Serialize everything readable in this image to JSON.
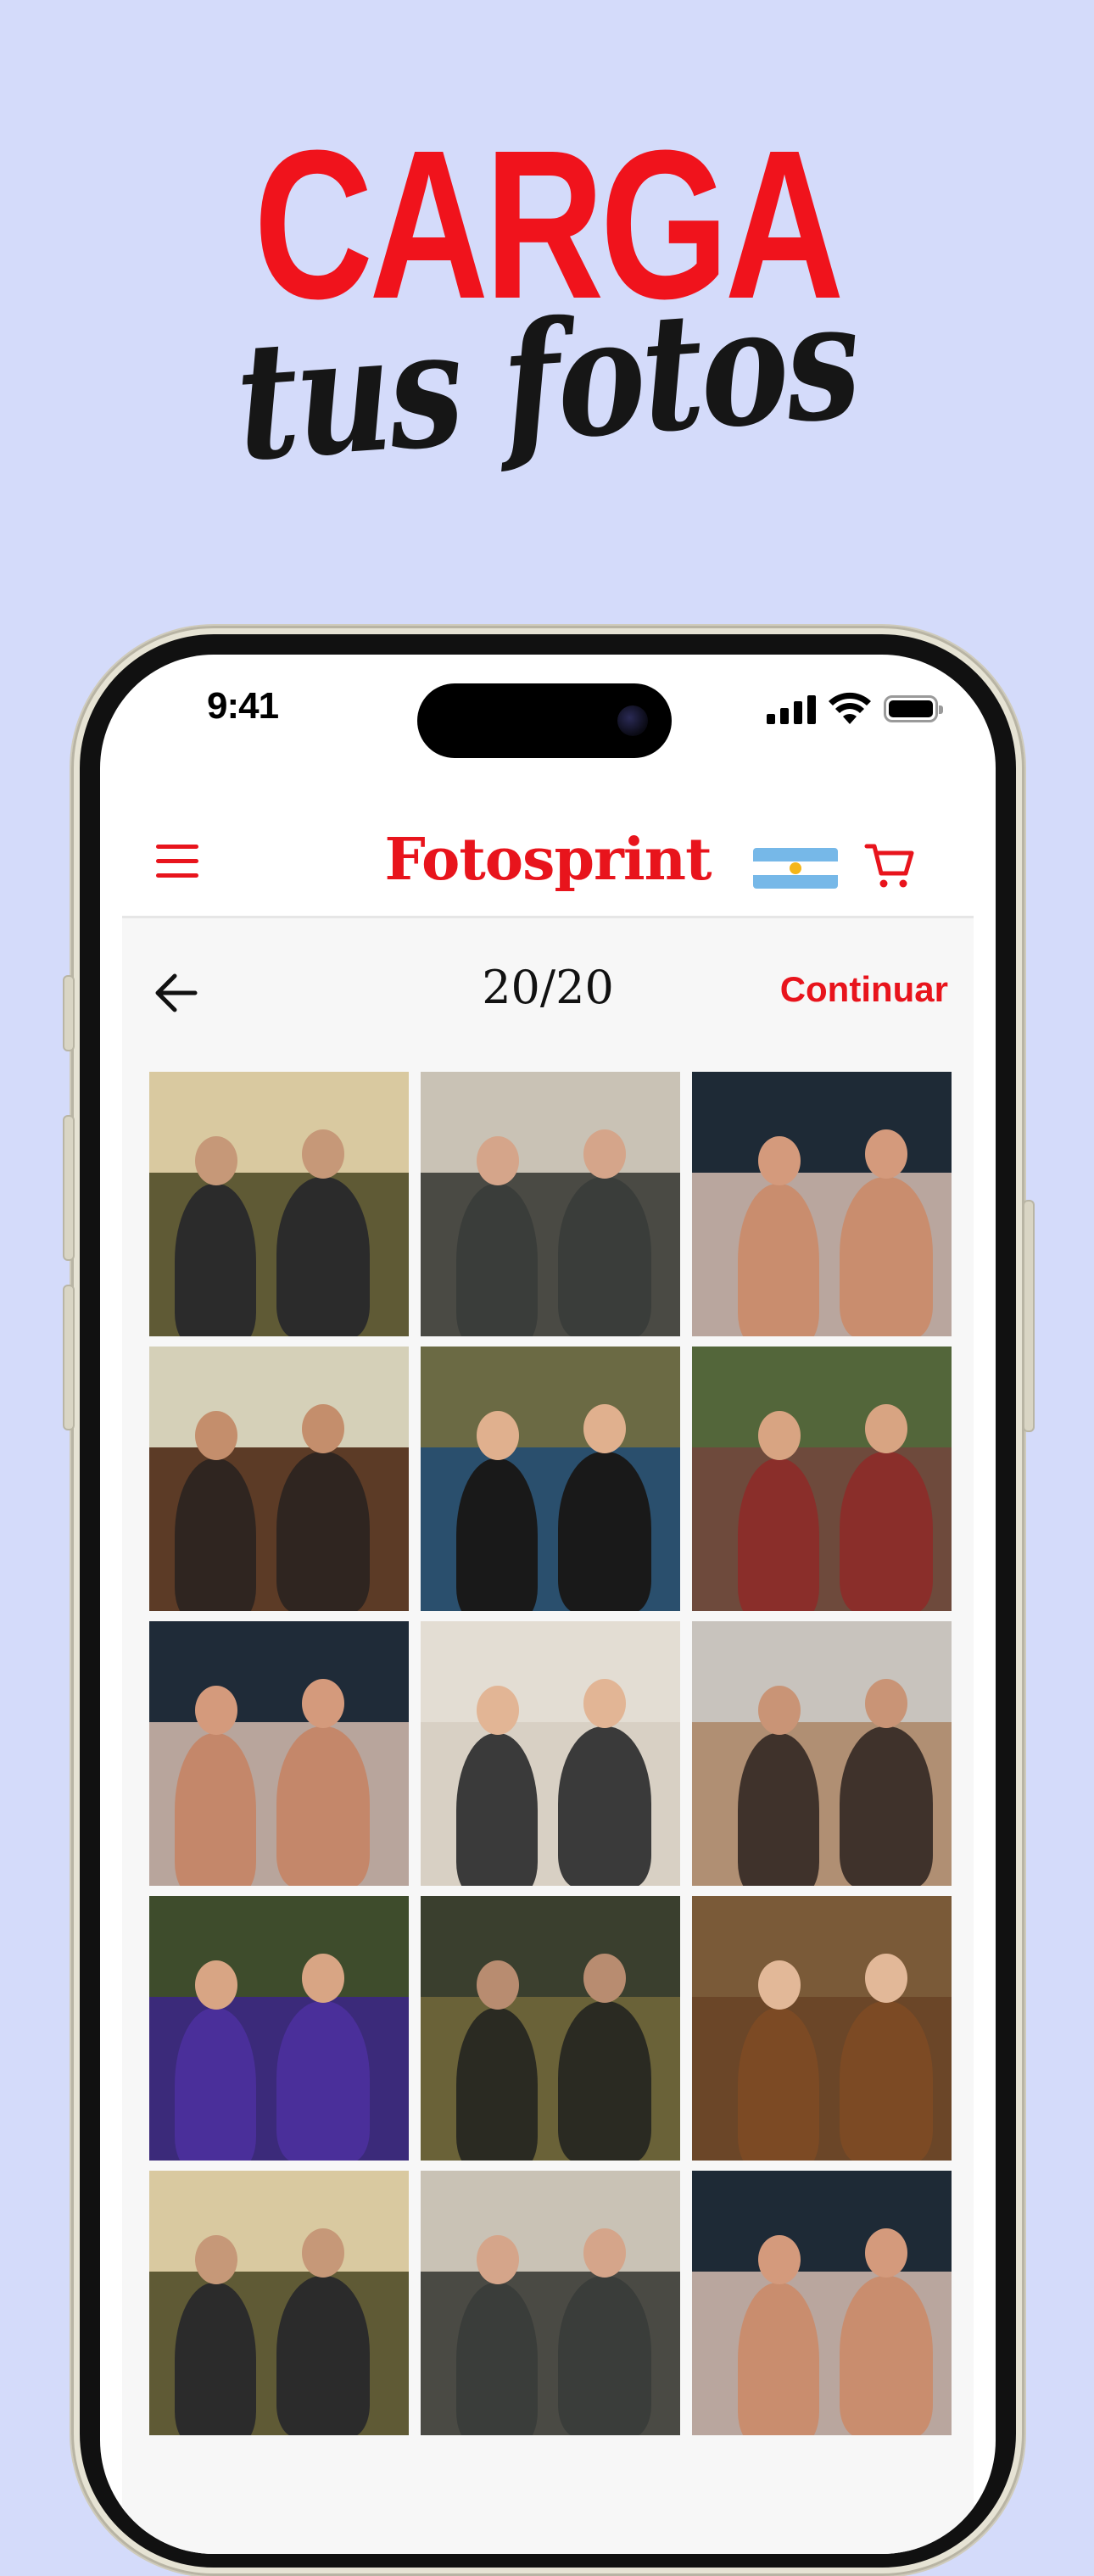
{
  "headline": {
    "big": "CARGA",
    "script": "tus fotos"
  },
  "status_bar": {
    "time": "9:41"
  },
  "header": {
    "logo": "Fotosprint",
    "flag": "argentina-flag",
    "cart": "cart-icon",
    "menu": "menu-icon"
  },
  "gallery": {
    "counter": "20/20",
    "continue_label": "Continuar",
    "photos": [
      {
        "desc": "park-picnic-sunset",
        "sky": "#d9c9a0",
        "ground": "#5f5a35",
        "fig": "#2b2b2b",
        "skin": "#c69878"
      },
      {
        "desc": "couple-laughing-balcony",
        "sky": "#c9c2b5",
        "ground": "#4a4a44",
        "fig": "#3a3d3a",
        "skin": "#d5a58a"
      },
      {
        "desc": "friends-by-water",
        "sky": "#1e2a36",
        "ground": "#b9a69e",
        "fig": "#c98d6e",
        "skin": "#d49a7c"
      },
      {
        "desc": "dinner-table-window",
        "sky": "#d5d0b8",
        "ground": "#5c3b26",
        "fig": "#2f2520",
        "skin": "#c48e6c"
      },
      {
        "desc": "picnic-pizza-grass",
        "sky": "#6b6a44",
        "ground": "#2a4f6d",
        "fig": "#191919",
        "skin": "#e0b08e"
      },
      {
        "desc": "laughing-knit-sweater",
        "sky": "#53663a",
        "ground": "#6e4a3c",
        "fig": "#8a2e2a",
        "skin": "#d8a482"
      },
      {
        "desc": "friends-by-water-2",
        "sky": "#1f2b38",
        "ground": "#b8a59c",
        "fig": "#c4876a",
        "skin": "#d49a7c"
      },
      {
        "desc": "hanging-frames-wall",
        "sky": "#e3ddd3",
        "ground": "#d8d0c4",
        "fig": "#3a3a3a",
        "skin": "#e2b595"
      },
      {
        "desc": "beach-sitting",
        "sky": "#c8c3bd",
        "ground": "#b08f73",
        "fig": "#3f322b",
        "skin": "#c99476"
      },
      {
        "desc": "sunglasses-colorful-sweater",
        "sky": "#3e4c2c",
        "ground": "#3b2a7a",
        "fig": "#4a2f9a",
        "skin": "#d8a584"
      },
      {
        "desc": "park-bicycles",
        "sky": "#3a3f2e",
        "ground": "#6a6238",
        "fig": "#2a2a22",
        "skin": "#b88c70"
      },
      {
        "desc": "woman-portrait-hallway",
        "sky": "#7a5a38",
        "ground": "#6b4628",
        "fig": "#7c4a24",
        "skin": "#e2b898"
      },
      {
        "desc": "park-picnic-sunset-2",
        "sky": "#d9c9a0",
        "ground": "#5f5a35",
        "fig": "#2b2b2b",
        "skin": "#c69878"
      },
      {
        "desc": "couple-laughing-balcony-2",
        "sky": "#c9c2b5",
        "ground": "#4a4a44",
        "fig": "#3a3d3a",
        "skin": "#d5a58a"
      },
      {
        "desc": "friends-by-water-3",
        "sky": "#1e2a36",
        "ground": "#b9a69e",
        "fig": "#c98d6e",
        "skin": "#d49a7c"
      }
    ]
  },
  "colors": {
    "brand_red": "#e8141c",
    "background": "#d4dbfa"
  }
}
